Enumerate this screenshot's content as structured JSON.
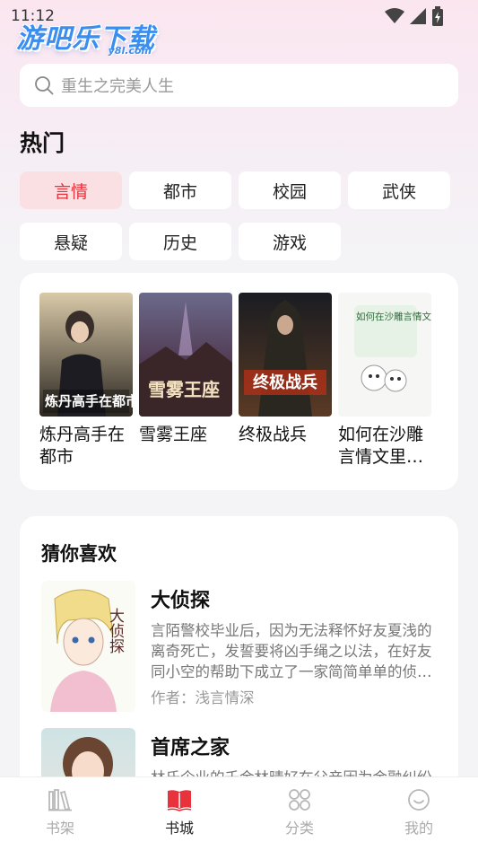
{
  "status_bar": {
    "time": "11:12",
    "icons": [
      "wifi-icon",
      "signal-icon",
      "battery-icon"
    ]
  },
  "logo": {
    "main": "游吧乐下载",
    "sub": "y8l.com"
  },
  "search": {
    "placeholder": "重生之完美人生",
    "icon": "search-icon"
  },
  "hot": {
    "title": "热门",
    "tags": [
      "言情",
      "都市",
      "校园",
      "武侠",
      "悬疑",
      "历史",
      "游戏"
    ],
    "active_tag": "言情",
    "books": [
      {
        "title": "炼丹高手在都市",
        "cover_text": "炼丹高手在都市"
      },
      {
        "title": "雪雾王座",
        "cover_text": "雪雾王座"
      },
      {
        "title": "终极战兵",
        "cover_text": "终极战兵"
      },
      {
        "title": "如何在沙雕言情文里活下去",
        "cover_text": "如何在沙雕言情文里活下去"
      }
    ]
  },
  "guess": {
    "title": "猜你喜欢",
    "items": [
      {
        "title": "大侦探",
        "desc": "言陌警校毕业后，因为无法释怀好友夏浅的离奇死亡，发誓要将凶手绳之以法，在好友同小空的帮助下成立了一家简简单单的侦探社。",
        "author": "作者：浅言情深",
        "cover_text": "大侦探"
      },
      {
        "title": "首席之家",
        "desc": "林氏企业的千金林晴好在父亲因为金融纠纷",
        "author": "",
        "cover_text": ""
      }
    ]
  },
  "tabbar": {
    "tabs": [
      {
        "label": "书架",
        "icon": "bookshelf-icon"
      },
      {
        "label": "书城",
        "icon": "bookstore-icon"
      },
      {
        "label": "分类",
        "icon": "category-icon"
      },
      {
        "label": "我的",
        "icon": "profile-icon"
      }
    ],
    "active": "书城"
  },
  "colors": {
    "accent": "#e8323c",
    "active_tag_bg": "#fbe0e3",
    "logo_blue": "#3a8ef0"
  }
}
